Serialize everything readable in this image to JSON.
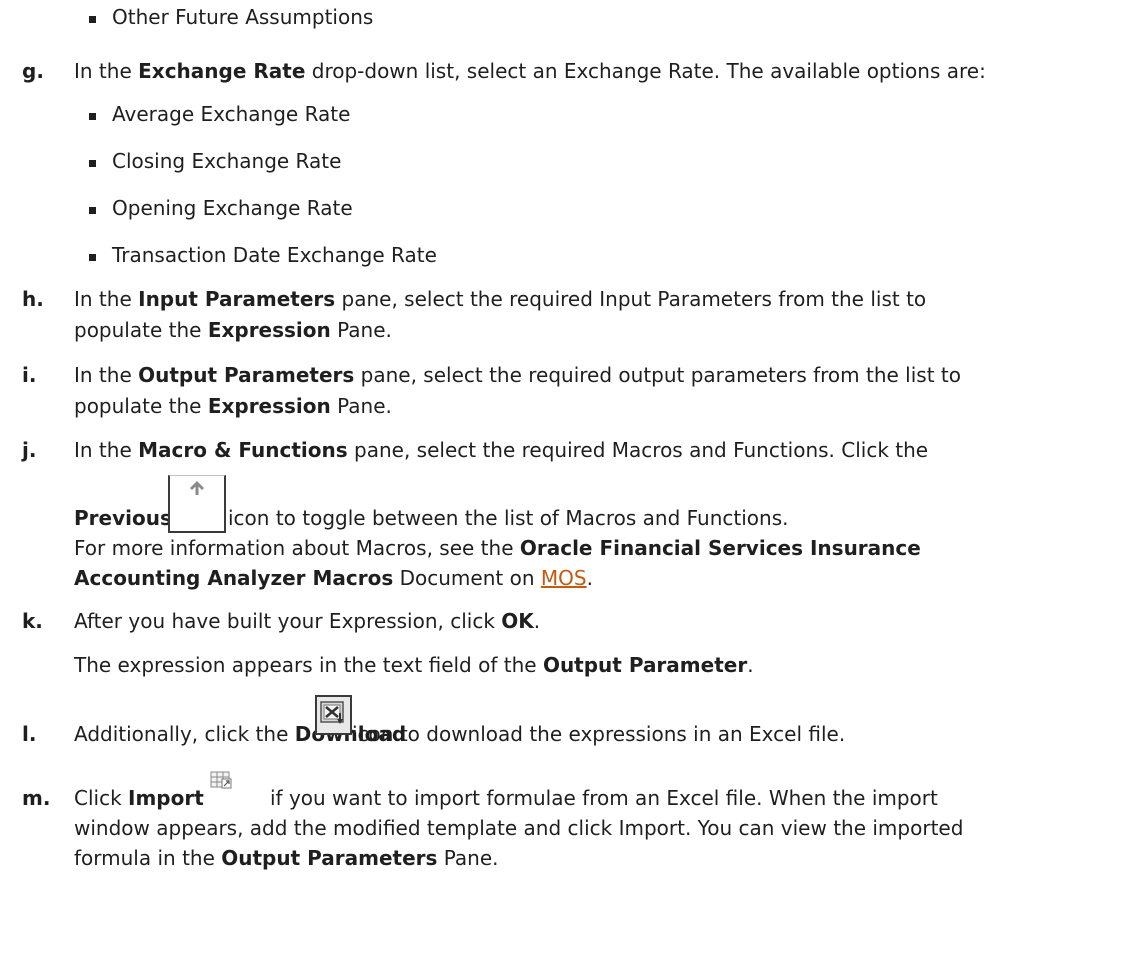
{
  "doc": {
    "top_bullet": "Other Future Assumptions",
    "g": {
      "letter": "g.",
      "pre": "In the ",
      "bold": "Exchange Rate",
      "post": " drop-down list, select an Exchange Rate. The available options are:",
      "options": [
        "Average Exchange Rate",
        "Closing Exchange Rate",
        "Opening Exchange Rate",
        "Transaction Date Exchange Rate"
      ]
    },
    "h": {
      "letter": "h.",
      "line1_pre": "In the ",
      "line1_bold": "Input Parameters",
      "line1_post": " pane, select the required Input Parameters from the list to",
      "line2_pre": "populate the ",
      "line2_bold": "Expression",
      "line2_post": " Pane."
    },
    "i": {
      "letter": "i.",
      "line1_pre": "In the ",
      "line1_bold": "Output Parameters",
      "line1_post": " pane, select the required output parameters from the list to",
      "line2_pre": "populate the ",
      "line2_bold": "Expression",
      "line2_post": " Pane."
    },
    "j": {
      "letter": "j.",
      "line1_pre": "In the ",
      "line1_bold": "Macro & Functions",
      "line1_post": " pane, select the required Macros and Functions. Click the",
      "previous_bold": "Previous",
      "previous_post": " icon to toggle between the list of Macros and Functions.",
      "more_pre": "For more information about Macros, see the ",
      "more_bold1": "Oracle Financial Services Insurance",
      "more_bold2": "Accounting Analyzer Macros",
      "more_mid": " Document on ",
      "more_link": "MOS",
      "more_end": "."
    },
    "k": {
      "letter": "k.",
      "pre": "After you have built your Expression, click ",
      "bold": "OK",
      "post": ".",
      "sub_pre": "The expression appears in the text field of the ",
      "sub_bold": "Output Parameter",
      "sub_post": "."
    },
    "l": {
      "letter": "l.",
      "pre": "Additionally, click the ",
      "bold": "Download",
      "post": "icon to download the expressions in an Excel file."
    },
    "m": {
      "letter": "m.",
      "pre": "Click ",
      "bold": "Import",
      "post": "if you want to import formulae from an Excel file. When the import",
      "line2": "window appears, add the modified template and click Import. You can view the imported",
      "line3_pre": "formula in the ",
      "line3_bold": "Output Parameters",
      "line3_post": " Pane."
    }
  },
  "icons": {
    "previous": "arrow-up-icon",
    "download": "excel-download-icon",
    "import": "import-icon"
  },
  "colors": {
    "text": "#1f1f1f",
    "link": "#c55a11"
  }
}
